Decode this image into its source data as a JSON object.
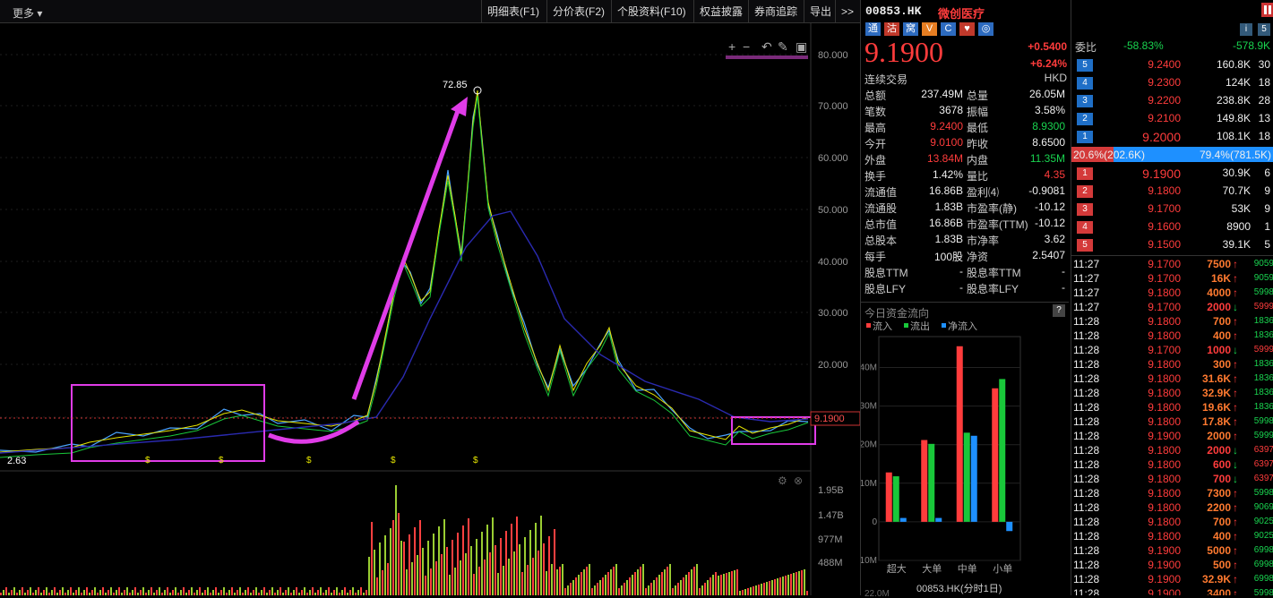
{
  "toolbar": {
    "more": "更多",
    "tabs": [
      "明细表(F1)",
      "分价表(F2)",
      "个股资料(F10)",
      "权益披露",
      "券商追踪",
      "导出"
    ],
    "expand": ">>"
  },
  "chart": {
    "price_axis": [
      "80.000",
      "70.000",
      "60.000",
      "50.000",
      "40.000",
      "30.000",
      "20.000",
      "10.000"
    ],
    "current_price_label": "9.1900",
    "peak_label": "72.85",
    "low_label": "2.63",
    "dividend_marker": "$",
    "volume_axis": [
      "1.95B",
      "1.47B",
      "977M",
      "488M"
    ],
    "tools": [
      "+",
      "−",
      "↶",
      "✎",
      "▣"
    ],
    "colors": {
      "annotation": "#e03ce8",
      "ma_long": "#2a2ab0",
      "ma_short": "#19c83a",
      "ma_mid": "#e6e600",
      "volume_up": "#ff4040",
      "volume_down": "#9acd32"
    }
  },
  "quote": {
    "code": "00853.HK",
    "name": "微创医疗",
    "badges": [
      "通",
      "沽",
      "窝",
      "V",
      "C",
      "♥",
      "◎"
    ],
    "price": "9.1900",
    "change": "+0.5400",
    "change_pct": "+6.24%",
    "status": "连续交易",
    "currency": "HKD",
    "stats": [
      [
        "总额",
        "237.49M",
        "总量",
        "26.05M"
      ],
      [
        "笔数",
        "3678",
        "振幅",
        "3.58%"
      ],
      [
        "最高",
        "9.2400",
        "最低",
        "8.9300"
      ],
      [
        "今开",
        "9.0100",
        "昨收",
        "8.6500"
      ],
      [
        "外盘",
        "13.84M",
        "内盘",
        "11.35M"
      ],
      [
        "换手",
        "1.42%",
        "量比",
        "4.35"
      ],
      [
        "流通值",
        "16.86B",
        "盈利⑷",
        "-0.9081"
      ],
      [
        "流通股",
        "1.83B",
        "市盈率(静)",
        "-10.12"
      ],
      [
        "总市值",
        "16.86B",
        "市盈率(TTM)",
        "-10.12"
      ],
      [
        "总股本",
        "1.83B",
        "市净率",
        "3.62"
      ],
      [
        "每手",
        "100股",
        "净资",
        "2.5407"
      ],
      [
        "股息TTM",
        "-",
        "股息率TTM",
        "-"
      ],
      [
        "股息LFY",
        "-",
        "股息率LFY",
        "-"
      ]
    ]
  },
  "orderbook": {
    "ratio_label": "委比",
    "ratio_pct": "-58.83%",
    "ratio_val": "-578.9K",
    "asks": [
      [
        "5",
        "9.2400",
        "160.8K",
        "30"
      ],
      [
        "4",
        "9.2300",
        "124K",
        "18"
      ],
      [
        "3",
        "9.2200",
        "238.8K",
        "28"
      ],
      [
        "2",
        "9.2100",
        "149.8K",
        "13"
      ],
      [
        "1",
        "9.2000",
        "108.1K",
        "18"
      ]
    ],
    "bid_pct": "20.6%(202.6K)",
    "ask_pct": "79.4%(781.5K)",
    "bids": [
      [
        "1",
        "9.1900",
        "30.9K",
        "6"
      ],
      [
        "2",
        "9.1800",
        "70.7K",
        "9"
      ],
      [
        "3",
        "9.1700",
        "53K",
        "9"
      ],
      [
        "4",
        "9.1600",
        "8900",
        "1"
      ],
      [
        "5",
        "9.1500",
        "39.1K",
        "5"
      ]
    ]
  },
  "ticks": [
    [
      "11:27",
      "9.1700",
      "7500",
      "↑",
      "9059"
    ],
    [
      "11:27",
      "9.1700",
      "16K",
      "↑",
      "9059"
    ],
    [
      "11:27",
      "9.1800",
      "4000",
      "↑",
      "5998"
    ],
    [
      "11:27",
      "9.1700",
      "2000",
      "↓",
      "5999"
    ],
    [
      "11:28",
      "9.1800",
      "700",
      "↑",
      "1836"
    ],
    [
      "11:28",
      "9.1800",
      "400",
      "↑",
      "1836"
    ],
    [
      "11:28",
      "9.1700",
      "1000",
      "↓",
      "5999"
    ],
    [
      "11:28",
      "9.1800",
      "300",
      "↑",
      "1836"
    ],
    [
      "11:28",
      "9.1800",
      "31.6K",
      "↑",
      "1836"
    ],
    [
      "11:28",
      "9.1800",
      "32.9K",
      "↑",
      "1836"
    ],
    [
      "11:28",
      "9.1800",
      "19.6K",
      "↑",
      "1836"
    ],
    [
      "11:28",
      "9.1800",
      "17.8K",
      "↑",
      "5998"
    ],
    [
      "11:28",
      "9.1900",
      "2000",
      "↑",
      "5999"
    ],
    [
      "11:28",
      "9.1800",
      "2000",
      "↓",
      "6397"
    ],
    [
      "11:28",
      "9.1800",
      "600",
      "↓",
      "6397"
    ],
    [
      "11:28",
      "9.1800",
      "700",
      "↓",
      "6397"
    ],
    [
      "11:28",
      "9.1800",
      "7300",
      "↑",
      "5998"
    ],
    [
      "11:28",
      "9.1800",
      "2200",
      "↑",
      "9069"
    ],
    [
      "11:28",
      "9.1800",
      "700",
      "↑",
      "9025"
    ],
    [
      "11:28",
      "9.1800",
      "400",
      "↑",
      "9025"
    ],
    [
      "11:28",
      "9.1900",
      "5000",
      "↑",
      "6998"
    ],
    [
      "11:28",
      "9.1900",
      "500",
      "↑",
      "6998"
    ],
    [
      "11:28",
      "9.1900",
      "32.9K",
      "↑",
      "6998"
    ],
    [
      "11:28",
      "9.1900",
      "3400",
      "↑",
      "5998"
    ]
  ],
  "fund_flow": {
    "title": "今日资金流向",
    "legend": [
      "流入",
      "流出",
      "净流入"
    ],
    "y_ticks": [
      "40M",
      "30M",
      "20M",
      "10M",
      "0",
      "-10M"
    ],
    "footer": "00853.HK(分时1日)",
    "axis_top": "22.0M"
  },
  "chart_data": {
    "type": "bar",
    "title": "今日资金流向",
    "categories": [
      "超大",
      "大单",
      "中单",
      "小单"
    ],
    "series": [
      {
        "name": "流入",
        "values": [
          12.8,
          21.2,
          45.5,
          34.6
        ]
      },
      {
        "name": "流出",
        "values": [
          11.8,
          20.2,
          23.1,
          37.0
        ]
      },
      {
        "name": "净流入",
        "values": [
          1.0,
          1.0,
          22.3,
          -2.4
        ]
      }
    ],
    "ylim": [
      -10,
      48
    ]
  }
}
